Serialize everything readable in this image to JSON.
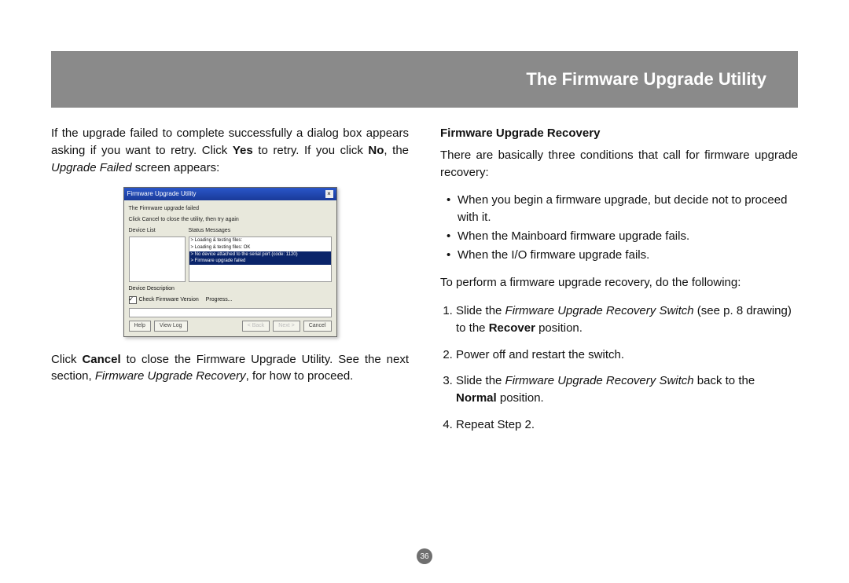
{
  "title": "The Firmware Upgrade Utility",
  "pageNumber": "36",
  "left": {
    "p1_a": "If the upgrade failed to complete successfully a dialog box appears asking if you want to retry. Click ",
    "p1_b_yes": "Yes",
    "p1_c": " to retry. If you click ",
    "p1_d_no": "No",
    "p1_e": ", the ",
    "p1_f_upgradeFailed": "Upgrade Failed",
    "p1_g": " screen appears:",
    "shot": {
      "title": "Firmware Upgrade Utility",
      "note": "The Firmware upgrade failed",
      "hint": "Click Cancel to close the utility, then try again",
      "deviceListLabel": "Device List",
      "statusLabel": "Status Messages",
      "msg1": "> Loading & testing files: ",
      "msg2": "> Loading & testing files: OK",
      "msg3": "> No device attached to the serial port (code: 1120)",
      "msg4": "> Firmware upgrade failed",
      "devDesc": "Device Description",
      "check": "Check Firmware Version",
      "progress": "Progress...",
      "btnHelp": "Help",
      "btnViewLog": "View Log",
      "btnBack": "< Back",
      "btnNext": "Next >",
      "btnCancel": "Cancel"
    },
    "p2_a": "Click ",
    "p2_b_cancel": "Cancel",
    "p2_c": " to close the Firmware Upgrade Utility. See the next section, ",
    "p2_d_recovery": "Firmware Upgrade Recovery",
    "p2_e": ", for how to proceed."
  },
  "right": {
    "h": "Firmware Upgrade Recovery",
    "p1": "There are basically three conditions that call for firmware upgrade recovery:",
    "bullets": [
      "When you begin a firmware upgrade, but decide not to proceed with it.",
      "When the Mainboard firmware upgrade fails.",
      "When the I/O firmware upgrade fails."
    ],
    "p2": "To perform a firmware upgrade recovery, do the following:",
    "step1_a": "Slide the ",
    "step1_b": "Firmware Upgrade Recovery Switch",
    "step1_c": " (see p. 8 drawing) to the ",
    "step1_d": "Recover",
    "step1_e": " position.",
    "step2": "Power off and restart the switch.",
    "step3_a": "Slide the ",
    "step3_b": "Firmware Upgrade Recovery Switch",
    "step3_c": " back to the ",
    "step3_d": "Normal",
    "step3_e": " position.",
    "step4": "Repeat Step 2."
  }
}
